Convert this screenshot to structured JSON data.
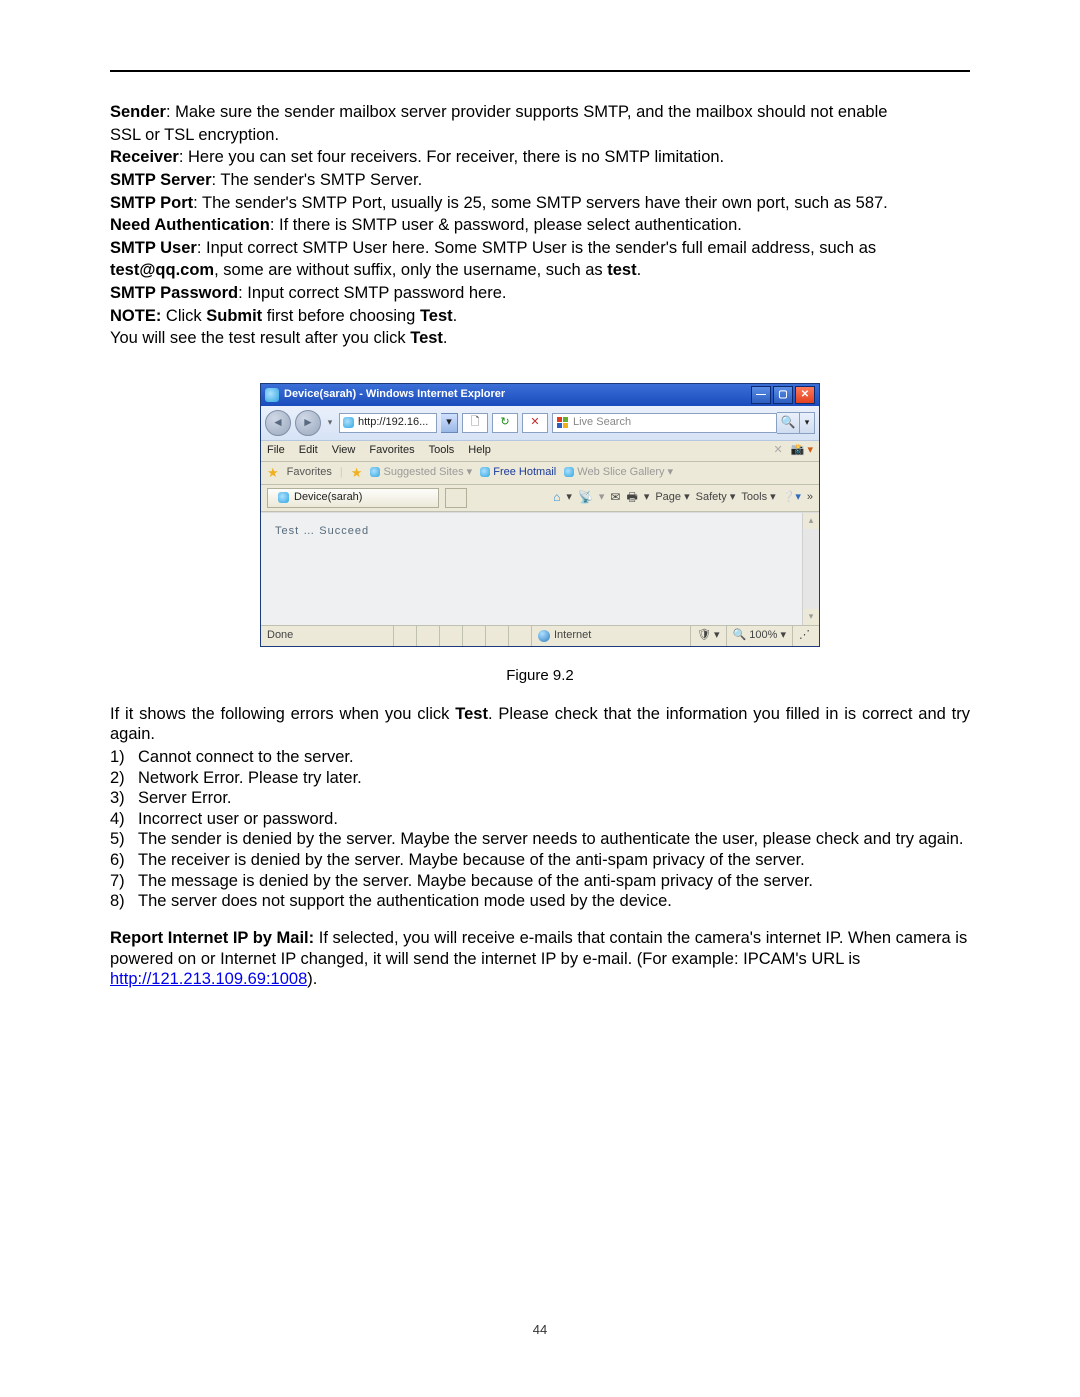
{
  "doc": {
    "sender_label": "Sender",
    "sender_text1": ": Make sure the sender mailbox server provider supports SMTP, and the mailbox should not enable",
    "sender_text2": "SSL or TSL encryption.",
    "receiver_label": "Receiver",
    "receiver_text": ": Here you can set four receivers. For receiver, there is no SMTP limitation.",
    "smtp_server_label": "SMTP Server",
    "smtp_server_text": ": The sender's SMTP Server.",
    "smtp_port_label": "SMTP Port",
    "smtp_port_text": ": The sender's SMTP Port, usually is 25, some SMTP servers have their own port, such as 587.",
    "need_auth_label": "Need Authentication",
    "need_auth_text": ": If there is SMTP user & password, please select authentication.",
    "smtp_user_label": "SMTP User",
    "smtp_user_text1": ": Input correct SMTP User here. Some SMTP User is the sender's full email address, such as",
    "smtp_user_email": "test@qq.com",
    "smtp_user_text2": ", some are without suffix, only the username, such as",
    "smtp_user_test": " test",
    "smtp_pass_label": "SMTP Password",
    "smtp_pass_text": ": Input correct SMTP password here.",
    "note_label": "NOTE: ",
    "note_text1": "Click",
    "note_submit": " Submit ",
    "note_text2": "first before choosing",
    "note_test": " Test",
    "after_test1": "You will see the test result after you click",
    "after_test_bold": " Test",
    "figure_caption": "Figure 9.2",
    "errors_intro1": "If it shows the following errors when you click",
    "errors_intro_bold": " Test",
    "errors_intro2": ". Please check that the information you filled in is correct and try again.",
    "errors": [
      "Cannot connect to the server.",
      "Network Error. Please try later.",
      "Server Error.",
      "Incorrect user or password.",
      "The sender is denied by the server. Maybe the server needs to authenticate the user, please check and try again.",
      "The receiver is denied by the server. Maybe because of the anti-spam privacy of the server.",
      "The message is denied by the server. Maybe because of the anti-spam privacy of the server.",
      "The server does not support the authentication mode used by the device."
    ],
    "report_label": "Report Internet IP by Mail: ",
    "report_text1": "If selected, you will receive e-mails that contain the camera's internet IP. When camera is powered on or Internet IP changed, it will send the internet IP by e-mail. (For example: IPCAM's URL is ",
    "report_url": "http://121.213.109.69:1008",
    "report_text2": ").",
    "page_number": "44"
  },
  "ie": {
    "title": "Device(sarah) - Windows Internet Explorer",
    "url": "http://192.16...",
    "search_placeholder": "Live Search",
    "menu": [
      "File",
      "Edit",
      "View",
      "Favorites",
      "Tools",
      "Help"
    ],
    "favorites_label": "Favorites",
    "suggested": "Suggested Sites",
    "free_hotmail": "Free Hotmail",
    "web_slice": "Web Slice Gallery",
    "tab_label": "Device(sarah)",
    "cmd": {
      "page": "Page",
      "safety": "Safety",
      "tools": "Tools"
    },
    "content": "Test … Succeed",
    "status_done": "Done",
    "status_zone": "Internet",
    "zoom": "100%"
  }
}
